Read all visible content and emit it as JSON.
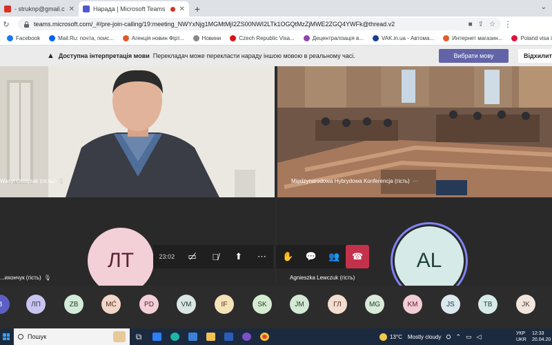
{
  "browser": {
    "tabs": [
      {
        "label": "- struknp@gmail.com - Gm",
        "favicon_color": "#d93025",
        "active": false
      },
      {
        "label": "Нарада | Microsoft Teams",
        "favicon_color": "#5059c9",
        "active": true
      }
    ],
    "address": {
      "url": "teams.microsoft.com/_#/pre-join-calling/19:meeting_NWYxNjg1MGMtMjI2ZS00NWI2LTk1OGQtMzZjMWE2ZGQ4YWFk@thread.v2"
    },
    "bookmarks": [
      {
        "label": "Facebook",
        "icon_color": "#1877f2"
      },
      {
        "label": "Mail.Ru: почта, поис...",
        "icon_color": "#005ff9"
      },
      {
        "label": "Агенція новин Фірт...",
        "icon_color": "#e05a28"
      },
      {
        "label": "Новини",
        "icon_color": "#888888"
      },
      {
        "label": "Czech Republic Visa...",
        "icon_color": "#d7141a"
      },
      {
        "label": "Децентралізація в...",
        "icon_color": "#8e44ad"
      },
      {
        "label": "VAK.in.ua - Автома...",
        "icon_color": "#1a3e8c"
      },
      {
        "label": "Интернет магазин...",
        "icon_color": "#e8592a"
      },
      {
        "label": "Poland visa informa...",
        "icon_color": "#dc143c"
      }
    ]
  },
  "banner": {
    "title": "Доступна інтерпретація мови",
    "message": "Перекладач може перекласти нараду іншою мовою в реальному часі.",
    "primary_button": "Вибрати мову",
    "secondary_button": "Відхилити"
  },
  "participants": {
    "tile1_name": "Wasyl Ostapiak (гість)",
    "tile2_name": "Międzynarodowa Hybrydowa Konferencja (гість)",
    "tile3_name": "...ихончук (гість)",
    "tile3_initials": "ЛТ",
    "tile4_name": "Agnieszka Lewczuk (гість)",
    "tile4_initials": "AL"
  },
  "controls": {
    "timer": "23:02"
  },
  "strip": [
    {
      "initials": "В",
      "bg": "#5c5fc4",
      "fg": "#ffffff"
    },
    {
      "initials": "ЛП",
      "bg": "#c8c6f0",
      "fg": "#33344a"
    },
    {
      "initials": "ZB",
      "bg": "#d3ecd9",
      "fg": "#2a3b2e"
    },
    {
      "initials": "MĆ",
      "bg": "#f2d6c7",
      "fg": "#4a2e22"
    },
    {
      "initials": "PD",
      "bg": "#f3cfd8",
      "fg": "#5a2235"
    },
    {
      "initials": "VM",
      "bg": "#d9e6e3",
      "fg": "#2b3a36"
    },
    {
      "initials": "IF",
      "bg": "#f5e2b8",
      "fg": "#4a3a12"
    },
    {
      "initials": "SK",
      "bg": "#d6ecd2",
      "fg": "#27402a"
    },
    {
      "initials": "JM",
      "bg": "#d3e9d5",
      "fg": "#27402a"
    },
    {
      "initials": "ГЛ",
      "bg": "#f4dccf",
      "fg": "#4a2e22"
    },
    {
      "initials": "MG",
      "bg": "#d9ead9",
      "fg": "#27402a"
    },
    {
      "initials": "KM",
      "bg": "#f3cdd6",
      "fg": "#5a2235"
    },
    {
      "initials": "JS",
      "bg": "#dbe9ef",
      "fg": "#23384a"
    },
    {
      "initials": "TB",
      "bg": "#d6ebe8",
      "fg": "#23403b"
    },
    {
      "initials": "JK",
      "bg": "#f2e6dc",
      "fg": "#4a3a2e"
    }
  ],
  "taskbar": {
    "search_label": "Пошук",
    "weather": "13°C",
    "weather_text": "Mostly cloudy",
    "lang_top": "УКР",
    "lang_bottom": "UKR",
    "time": "12:33",
    "date": "20.04.20"
  }
}
